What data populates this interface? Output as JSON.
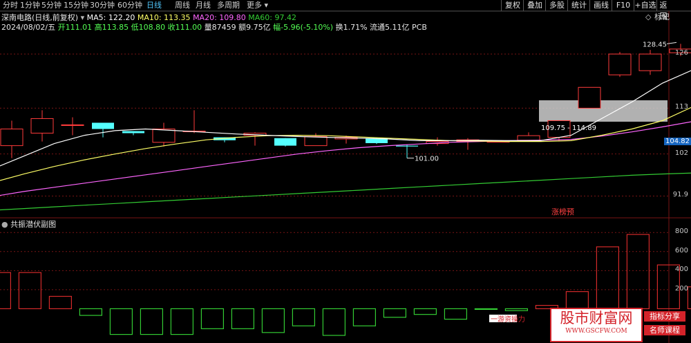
{
  "toolbar": {
    "periods": [
      "分时",
      "1分钟",
      "5分钟",
      "15分钟",
      "30分钟",
      "60分钟",
      "日线",
      "周线",
      "月线",
      "多周期",
      "更多"
    ],
    "active_period": "日线",
    "right_buttons": [
      "复权",
      "叠加",
      "多股",
      "统计",
      "画线",
      "F10",
      "+自选",
      "返回"
    ],
    "settings_label": "标记",
    "dropdown_glyph": "▾"
  },
  "stock": {
    "name": "深南电路(日线,前复权)",
    "ma5": "MA5: 122.20",
    "ma10": "MA10: 113.35",
    "ma20": "MA20: 109.80",
    "ma60": "MA60: 97.42",
    "date": "2024/08/02/五",
    "open": "开111.01",
    "high": "高113.85",
    "low": "低108.80",
    "close": "收111.00",
    "volume": "量87459",
    "amount": "额9.75亿",
    "change": "幅-5.96(-5.10%)",
    "turnover": "换1.71%",
    "float": "流通5.11亿",
    "sector": "PCB"
  },
  "price_axis": {
    "labels": [
      "126",
      "113",
      "104.82",
      "102",
      "91.9"
    ],
    "current": "104.82"
  },
  "annotations": {
    "high_mark": "128.45",
    "low_mark": "101.00",
    "zone": "109.75 - 114.89",
    "limit_tag": "涨榜预"
  },
  "sub_panel": {
    "title": "共振潜伏副图",
    "axis_labels": [
      "800",
      "600",
      "400",
      "200"
    ],
    "legend_text": "一游资操力"
  },
  "watermark": {
    "main": "股市财富网",
    "url": "WWW.GSCFW.COM",
    "tag1": "指标分享",
    "tag2": "名师课程"
  },
  "colors": {
    "up": "#ff3b3b",
    "down": "#54ffff",
    "ma5": "#ffffff",
    "ma10": "#ffff66",
    "ma20": "#ff66ff",
    "ma60": "#33cc33",
    "grid": "#7a1414",
    "bar_up": "#d42a2a",
    "bar_down": "#33cc33"
  },
  "chart_data": [
    {
      "type": "candlestick",
      "title": "深南电路(日线,前复权)",
      "candles": [
        {
          "o": 104.0,
          "h": 110.0,
          "l": 101.0,
          "c": 108.0
        },
        {
          "o": 107.0,
          "h": 112.5,
          "l": 105.0,
          "c": 110.5
        },
        {
          "o": 109.0,
          "h": 110.8,
          "l": 106.5,
          "c": 109.0
        },
        {
          "o": 109.5,
          "h": 109.5,
          "l": 106.0,
          "c": 108.0
        },
        {
          "o": 107.5,
          "h": 107.5,
          "l": 106.5,
          "c": 107.0
        },
        {
          "o": 104.8,
          "h": 109.5,
          "l": 103.8,
          "c": 108.0
        },
        {
          "o": 107.5,
          "h": 112.5,
          "l": 107.0,
          "c": 107.5
        },
        {
          "o": 106.0,
          "h": 106.0,
          "l": 104.8,
          "c": 105.3
        },
        {
          "o": 106.5,
          "h": 107.2,
          "l": 104.0,
          "c": 107.0
        },
        {
          "o": 105.8,
          "h": 105.8,
          "l": 103.8,
          "c": 104.0
        },
        {
          "o": 104.0,
          "h": 107.0,
          "l": 104.0,
          "c": 106.2
        },
        {
          "o": 105.6,
          "h": 106.4,
          "l": 104.5,
          "c": 106.0
        },
        {
          "o": 105.8,
          "h": 105.8,
          "l": 104.4,
          "c": 104.6
        },
        {
          "o": 104.0,
          "h": 104.2,
          "l": 101.0,
          "c": 103.8
        },
        {
          "o": 104.5,
          "h": 106.0,
          "l": 104.0,
          "c": 105.0
        },
        {
          "o": 105.0,
          "h": 105.8,
          "l": 103.0,
          "c": 105.4
        },
        {
          "o": 105.0,
          "h": 105.0,
          "l": 104.9,
          "c": 105.0
        },
        {
          "o": 105.3,
          "h": 107.2,
          "l": 105.0,
          "c": 106.4
        },
        {
          "o": 106.0,
          "h": 110.0,
          "l": 105.0,
          "c": 110.0
        },
        {
          "o": 113.0,
          "h": 118.0,
          "l": 113.0,
          "c": 118.0
        },
        {
          "o": 121.0,
          "h": 126.5,
          "l": 120.5,
          "c": 126.0
        },
        {
          "o": 122.0,
          "h": 127.0,
          "l": 121.0,
          "c": 126.0
        },
        {
          "o": 126.3,
          "h": 128.45,
          "l": 125.5,
          "c": 127.2
        }
      ],
      "ma5": [
        98.5,
        101.5,
        104.5,
        106.5,
        107.6,
        108.0,
        107.6,
        107.2,
        106.8,
        106.5,
        106.2,
        106.0,
        105.8,
        105.6,
        105.2,
        105.2,
        105.3,
        105.2,
        105.2,
        106.5,
        110.5,
        114.5,
        119.0,
        122.2
      ],
      "ma10": [
        95.2,
        97.2,
        99.0,
        100.6,
        102.0,
        103.3,
        104.4,
        105.4,
        106.0,
        106.4,
        106.5,
        106.4,
        106.1,
        105.8,
        105.5,
        105.2,
        105.1,
        105.0,
        105.0,
        105.2,
        106.5,
        108.0,
        110.0,
        113.35
      ],
      "ma20": [
        91.8,
        93.0,
        94.0,
        95.0,
        96.0,
        97.0,
        98.0,
        99.0,
        100.0,
        101.0,
        102.0,
        102.8,
        103.5,
        104.0,
        104.4,
        104.8,
        105.0,
        105.2,
        105.3,
        105.5,
        106.3,
        107.3,
        108.5,
        109.8
      ],
      "ma60": [
        88.5,
        88.9,
        89.3,
        89.7,
        90.1,
        90.5,
        90.9,
        91.3,
        91.7,
        92.1,
        92.5,
        92.9,
        93.3,
        93.7,
        94.1,
        94.5,
        94.9,
        95.3,
        95.7,
        96.1,
        96.5,
        96.9,
        97.2,
        97.42
      ],
      "ylim": [
        87,
        131
      ],
      "zone": [
        109.75,
        114.89
      ]
    },
    {
      "type": "bar",
      "title": "共振潜伏副图",
      "values": [
        380,
        380,
        130,
        -70,
        -270,
        -270,
        -270,
        -210,
        -210,
        -250,
        -180,
        -280,
        -180,
        -90,
        -60,
        -110,
        -5,
        -20,
        35,
        180,
        650,
        780,
        460,
        230
      ],
      "ylim": [
        -360,
        860
      ],
      "yticks": [
        800,
        600,
        400,
        200
      ]
    }
  ]
}
